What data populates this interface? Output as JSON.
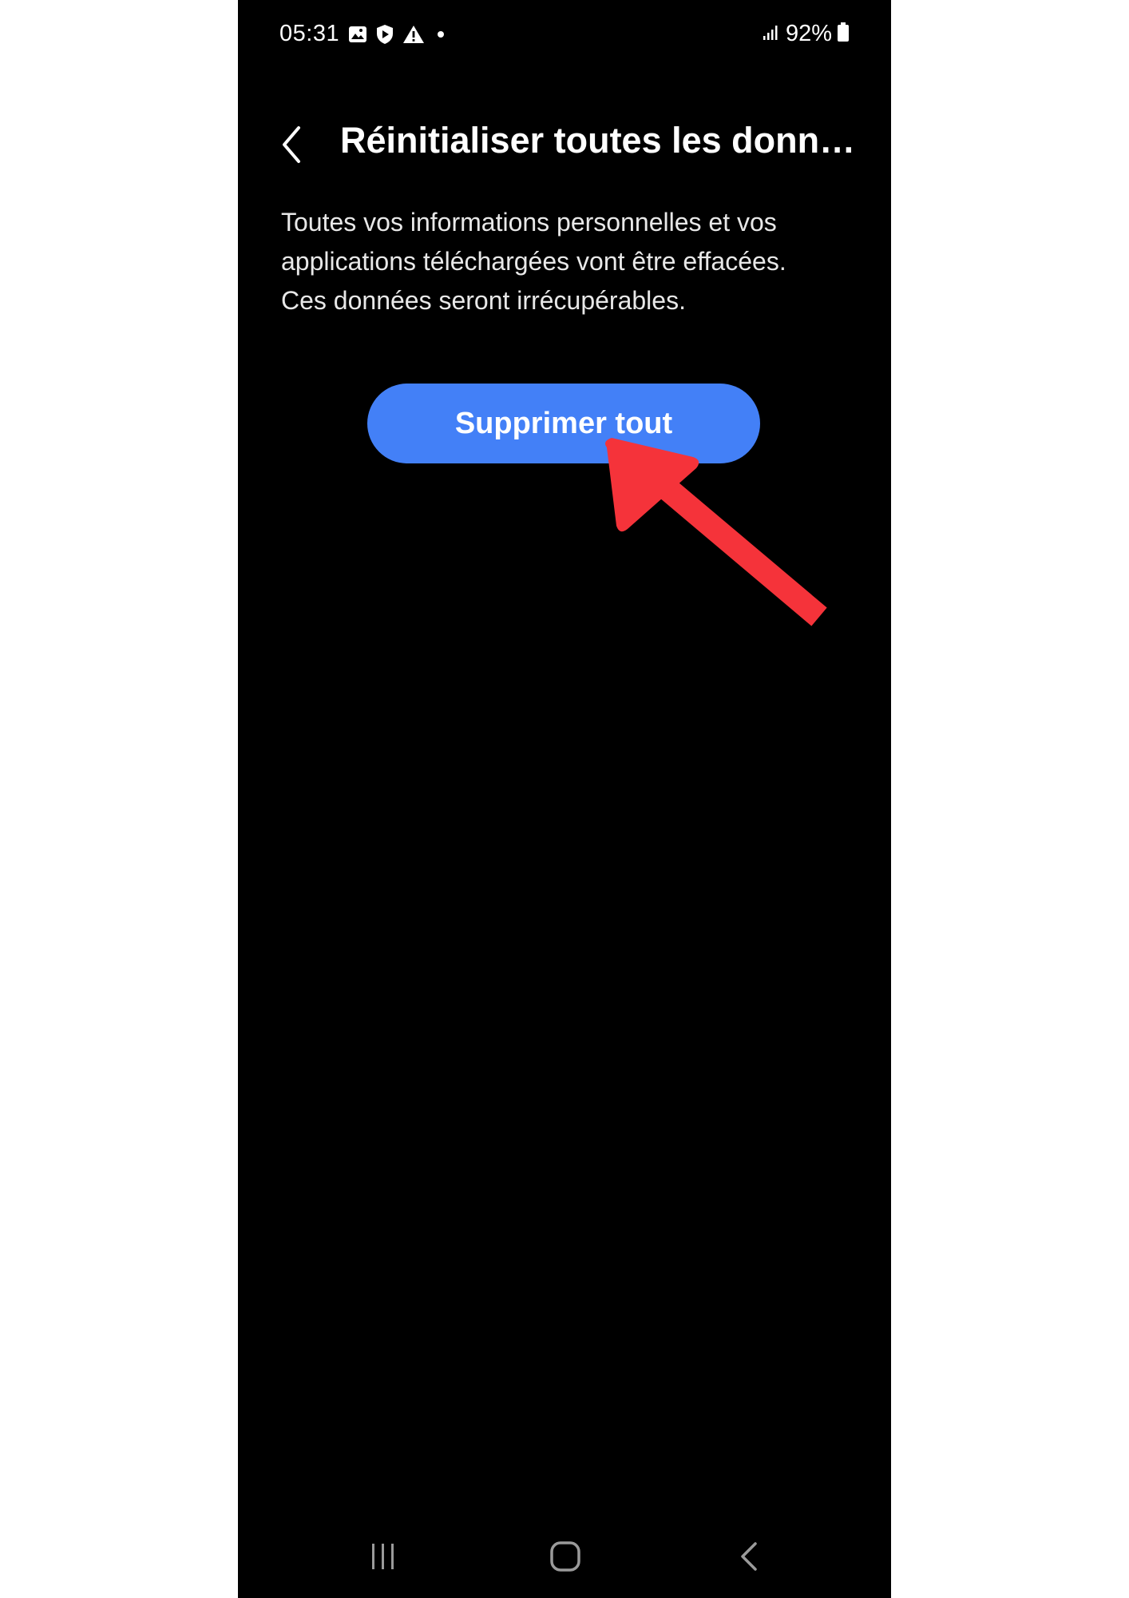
{
  "status_bar": {
    "time": "05:31",
    "battery": "92%",
    "icons": [
      "gallery-icon",
      "shield-play-icon",
      "warning-icon",
      "dot-icon",
      "signal-icon",
      "battery-icon"
    ]
  },
  "header": {
    "title": "Réinitialiser toutes les donn…",
    "back_icon": "chevron-left-icon"
  },
  "description": {
    "lines": [
      "Toutes vos informations personnelles et vos",
      "applications téléchargées vont être effacées.",
      "Ces données seront irrécupérables."
    ]
  },
  "actions": {
    "delete_all_label": "Supprimer tout"
  },
  "nav_bar": {
    "icons": [
      "recents-icon",
      "home-icon",
      "back-icon"
    ]
  },
  "colors": {
    "background": "#000000",
    "button": "#4380f7",
    "arrow": "#f5333a"
  }
}
